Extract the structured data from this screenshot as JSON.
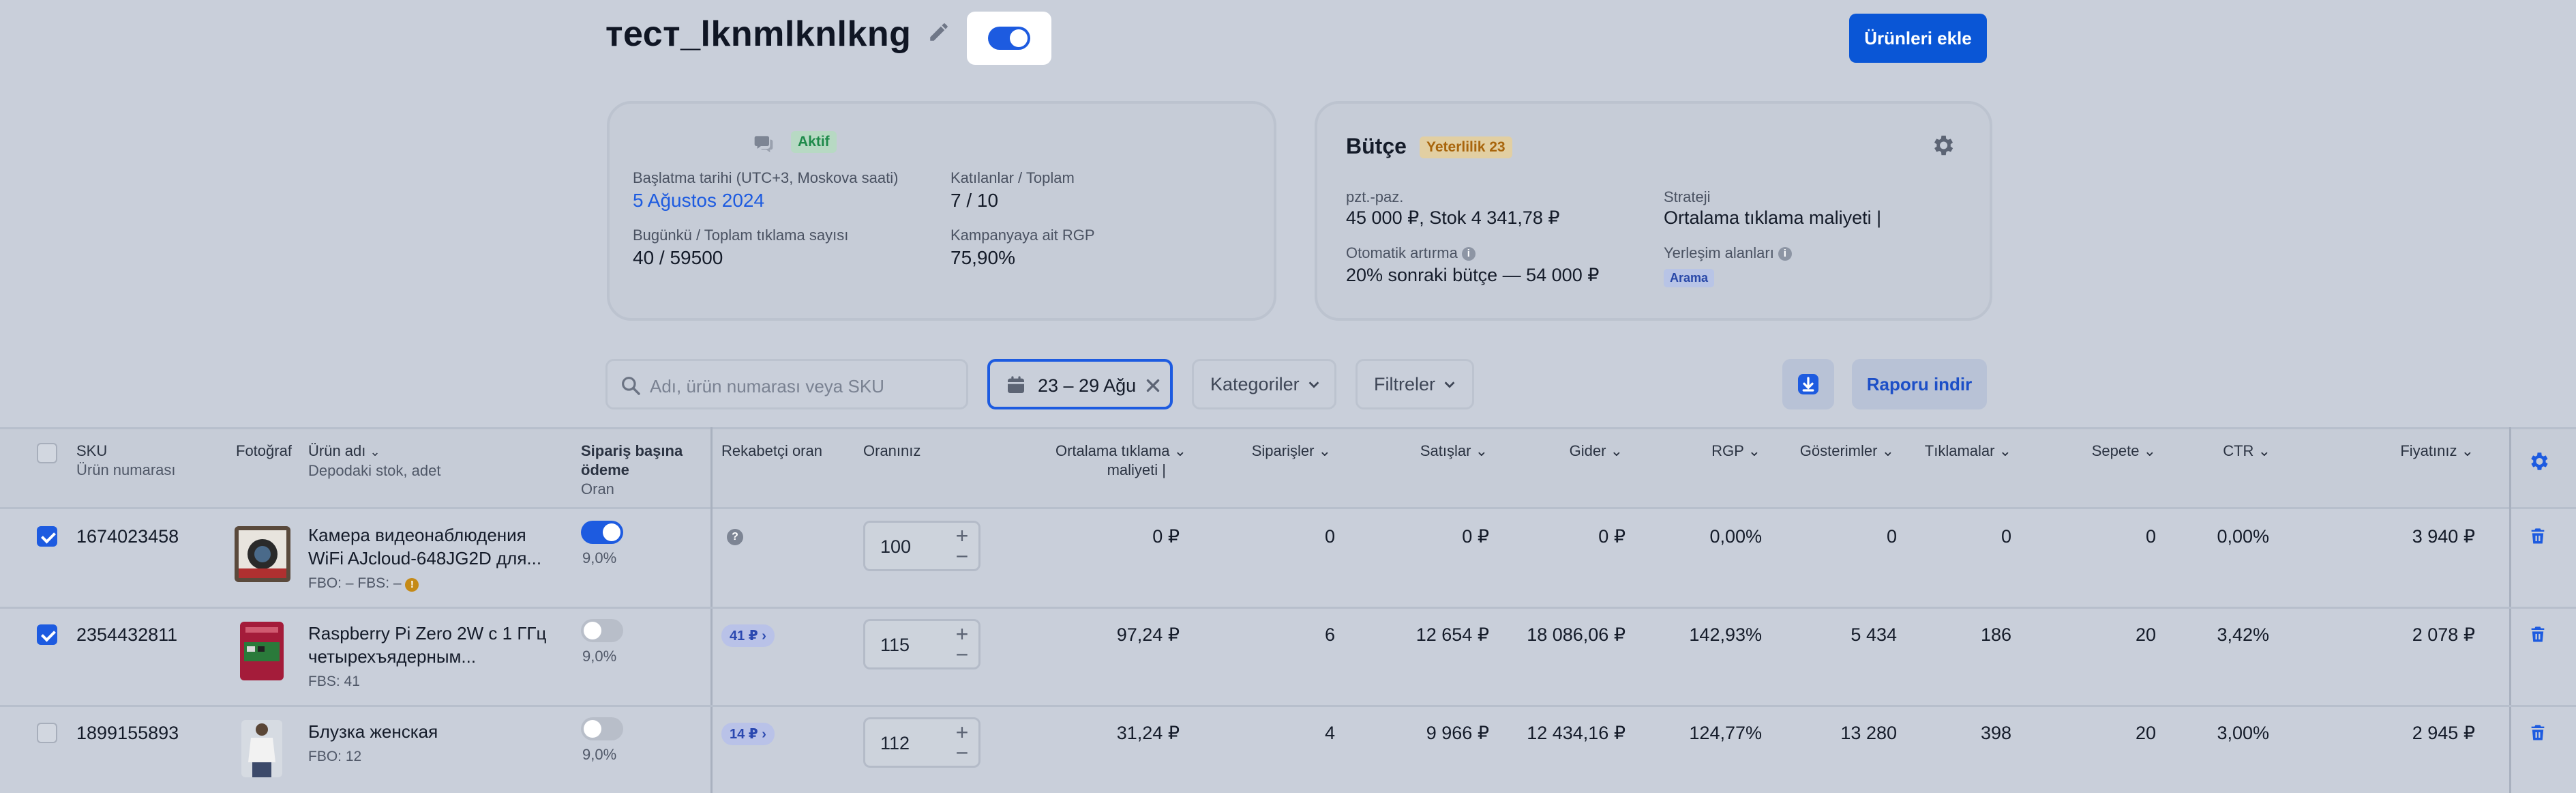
{
  "campaign": {
    "title": "тест_lknmlknlkng",
    "add_products_label": "Ürünleri ekle"
  },
  "info_card": {
    "status": "Aktif",
    "start_date_label": "Başlatma tarihi (UTC+3, Moskova saati)",
    "start_date": "5 Ağustos 2024",
    "participants_label": "Katılanlar / Toplam",
    "participants": "7 / 10",
    "clicks_label": "Bugünkü / Toplam tıklama sayısı",
    "clicks": "40 / 59500",
    "rgp_label": "Kampanyaya ait RGP",
    "rgp": "75,90%"
  },
  "budget_card": {
    "title": "Bütçe",
    "sufficiency": "Yeterlilik 23",
    "budget_label": "pzt.-paz.",
    "budget_value": "45 000 ₽, Stok 4 341,78 ₽",
    "strategy_label": "Strateji",
    "strategy_value": "Ortalama tıklama maliyeti |",
    "auto_label": "Otomatik artırma",
    "auto_value": "20% sonraki bütçe — 54 000 ₽",
    "placement_label": "Yerleşim alanları",
    "placement_value": "Arama"
  },
  "filters": {
    "search_placeholder": "Adı, ürün numarası veya SKU",
    "date_range": "23 – 29 Ağu",
    "categories": "Kategoriler",
    "filters": "Filtreler",
    "report": "Raporu indir"
  },
  "table": {
    "headers": {
      "sku": "SKU",
      "sku_sub": "Ürün numarası",
      "photo": "Fotoğraf",
      "name": "Ürün adı",
      "name_sub": "Depodaki stok, adet",
      "order_rate_1": "Sipariş başına",
      "order_rate_2": "ödeme",
      "order_rate_sub": "Oran",
      "competitor": "Rekabetçi oran",
      "your_rate": "Oranınız",
      "avg_cpc_1": "Ortalama tıklama",
      "avg_cpc_2": "maliyeti |",
      "orders": "Siparişler",
      "sales": "Satışlar",
      "expenses": "Gider",
      "rgp": "RGP",
      "impressions": "Gösterimler",
      "clicks": "Tıklamalar",
      "cart": "Sepete",
      "ctr": "CTR",
      "price": "Fiyatınız"
    },
    "rows": [
      {
        "checked": true,
        "sku": "1674023458",
        "name_1": "Камера видеонаблюдения",
        "name_2": "WiFi AJcloud-648JG2D для...",
        "stock": "FBO: –    FBS: –",
        "order_toggle": true,
        "order_pct": "9,0%",
        "competitor": "",
        "rate": "100",
        "avg_cpc": "0 ₽",
        "orders": "0",
        "sales": "0 ₽",
        "expenses": "0 ₽",
        "rgp": "0,00%",
        "impressions": "0",
        "clicks": "0",
        "cart": "0",
        "ctr": "0,00%",
        "price": "3 940 ₽"
      },
      {
        "checked": true,
        "sku": "2354432811",
        "name_1": "Raspberry Pi Zero 2W с 1 ГГц",
        "name_2": "четырехъядерным...",
        "stock": "FBS: 41",
        "order_toggle": false,
        "order_pct": "9,0%",
        "competitor": "41 ₽ ›",
        "rate": "115",
        "avg_cpc": "97,24 ₽",
        "orders": "6",
        "sales": "12 654 ₽",
        "expenses": "18 086,06 ₽",
        "rgp": "142,93%",
        "impressions": "5 434",
        "clicks": "186",
        "cart": "20",
        "ctr": "3,42%",
        "price": "2 078 ₽"
      },
      {
        "checked": false,
        "sku": "1899155893",
        "name_1": "Блузка женская",
        "name_2": "",
        "stock": "FBO: 12",
        "order_toggle": false,
        "order_pct": "9,0%",
        "competitor": "14 ₽ ›",
        "rate": "112",
        "avg_cpc": "31,24 ₽",
        "orders": "4",
        "sales": "9 966 ₽",
        "expenses": "12 434,16 ₽",
        "rgp": "124,77%",
        "impressions": "13 280",
        "clicks": "398",
        "cart": "20",
        "ctr": "3,00%",
        "price": "2 945 ₽"
      }
    ]
  },
  "colors": {
    "primary": "#0a56d6",
    "overlay_bg": "#c9cfda",
    "status_green": "#1e8a4a",
    "warning_orange": "#a8650c"
  }
}
